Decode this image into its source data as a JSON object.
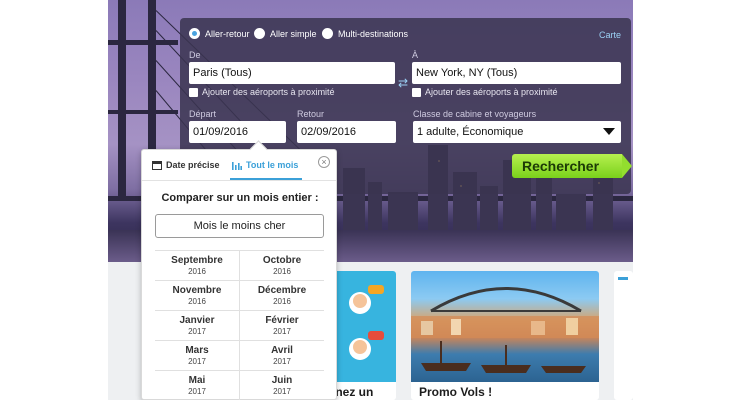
{
  "search": {
    "trip_types": [
      "Aller-retour",
      "Aller simple",
      "Multi-destinations"
    ],
    "map_link": "Carte",
    "from_label": "De",
    "from_value": "Paris (Tous)",
    "to_label": "À",
    "to_value": "New York, NY (Tous)",
    "nearby_from": "Ajouter des aéroports à proximité",
    "nearby_to": "Ajouter des aéroports à proximité",
    "depart_label": "Départ",
    "depart_value": "01/09/2016",
    "return_label": "Retour",
    "return_value": "02/09/2016",
    "cabin_label": "Classe de cabine et voyageurs",
    "cabin_value": "1 adulte, Économique",
    "search_button": "Rechercher",
    "accent": "#4aa3df",
    "button_color": "#8ed92a"
  },
  "date_picker": {
    "tabs": [
      "Date précise",
      "Tout le mois"
    ],
    "active_tab": "Tout le mois",
    "compare_title": "Comparer sur un mois entier :",
    "cheapest_button": "Mois le moins cher",
    "months": [
      {
        "name": "Septembre",
        "year": "2016"
      },
      {
        "name": "Octobre",
        "year": "2016"
      },
      {
        "name": "Novembre",
        "year": "2016"
      },
      {
        "name": "Décembre",
        "year": "2016"
      },
      {
        "name": "Janvier",
        "year": "2017"
      },
      {
        "name": "Février",
        "year": "2017"
      },
      {
        "name": "Mars",
        "year": "2017"
      },
      {
        "name": "Avril",
        "year": "2017"
      },
      {
        "name": "Mai",
        "year": "2017"
      },
      {
        "name": "Juin",
        "year": "2017"
      }
    ]
  },
  "cards": {
    "card1_title": "gnez un",
    "card2_title": "Promo Vols !"
  },
  "icons": {
    "calendar": "calendar-icon",
    "bars": "bar-chart-icon",
    "close": "close-icon",
    "swap": "swap-arrows-icon",
    "dropdown": "dropdown-arrow-icon"
  }
}
